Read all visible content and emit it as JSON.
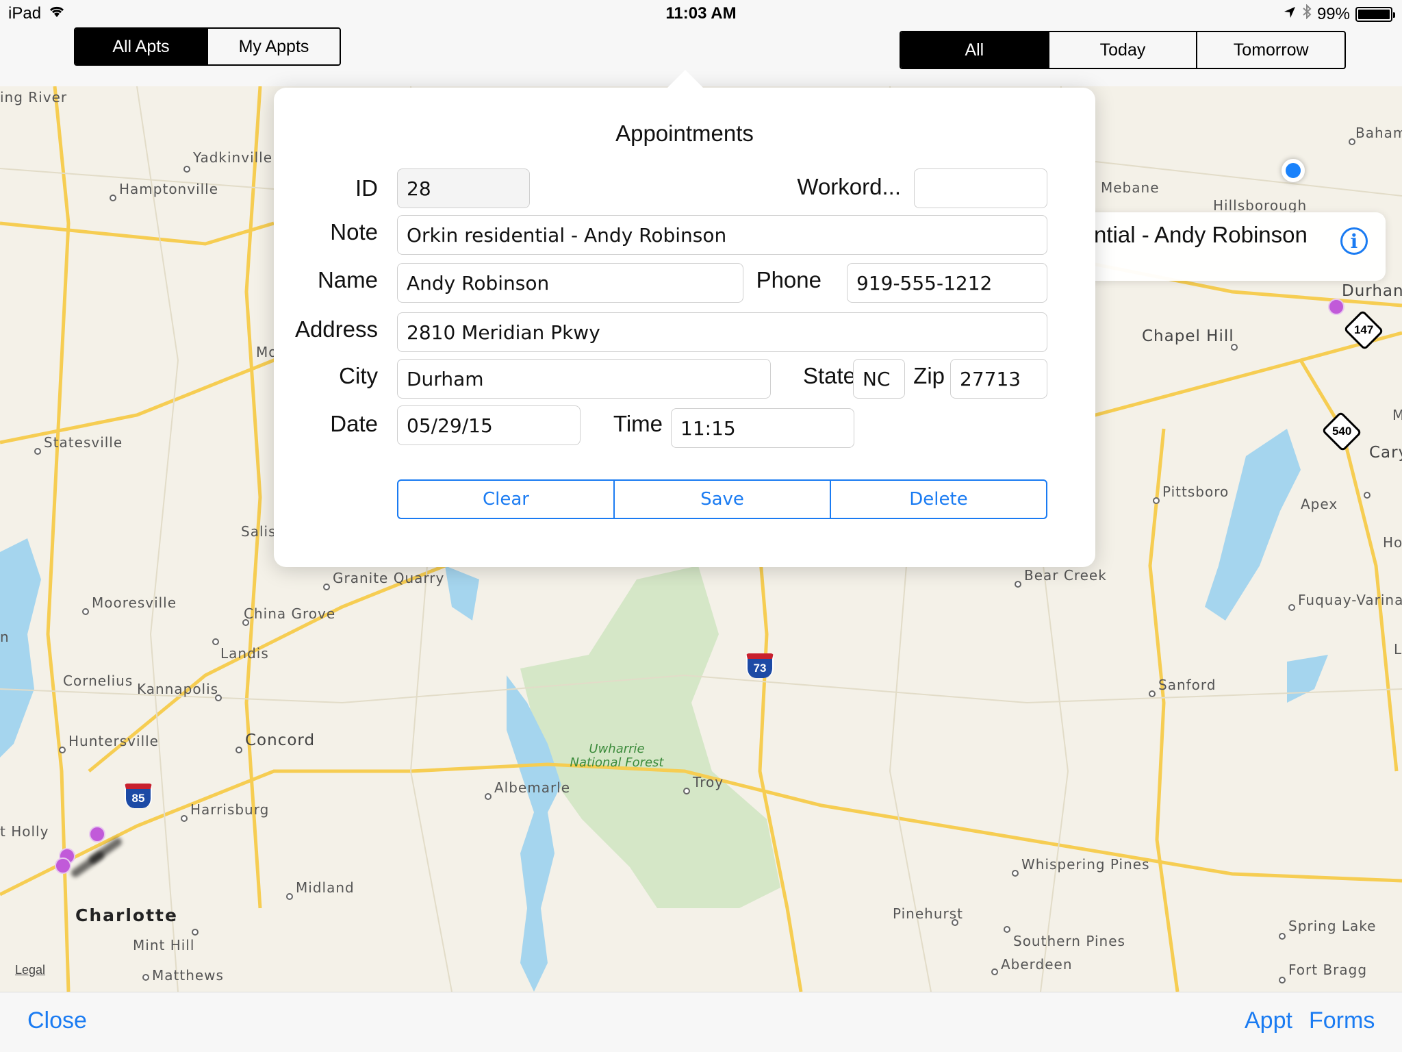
{
  "status_bar": {
    "device": "iPad",
    "time": "11:03 AM",
    "battery": "99%",
    "battery_level": 0.99
  },
  "toolbar": {
    "appt_scope": {
      "options": [
        "All Apts",
        "My Appts"
      ],
      "selected": "All Apts"
    },
    "date_filter": {
      "options": [
        "All",
        "Today",
        "Tomorrow"
      ],
      "selected": "All"
    }
  },
  "popover": {
    "title": "Appointments",
    "labels": {
      "id": "ID",
      "workorder": "Workord...",
      "note": "Note",
      "name": "Name",
      "phone": "Phone",
      "address": "Address",
      "city": "City",
      "state": "State",
      "zip": "Zip",
      "date": "Date",
      "time": "Time"
    },
    "values": {
      "id": "28",
      "workorder": "",
      "note": "Orkin residential - Andy Robinson",
      "name": "Andy Robinson",
      "phone": "919-555-1212",
      "address": "2810 Meridian Pkwy",
      "city": "Durham",
      "state": "NC",
      "zip": "27713",
      "date": "05/29/15",
      "time": "11:15"
    },
    "buttons": {
      "clear": "Clear",
      "save": "Save",
      "delete": "Delete"
    }
  },
  "map": {
    "callout_text": "ntial - Andy Robinson",
    "labels": {
      "ing_river": "ing River",
      "yadkinville": "Yadkinville",
      "hamptonville": "Hamptonville",
      "statesville": "Statesville",
      "mo": "Mo",
      "salis": "Salis",
      "mooresville": "Mooresville",
      "granite_quarry": "Granite Quarry",
      "china_grove": "China Grove",
      "landis": "Landis",
      "n": "n",
      "cornelius": "Cornelius",
      "kannapolis": "Kannapolis",
      "huntersville": "Huntersville",
      "concord": "Concord",
      "harrisburg": "Harrisburg",
      "holly": "t Holly",
      "charlotte": "Charlotte",
      "mint_hill": "Mint Hill",
      "matthews": "Matthews",
      "midland": "Midland",
      "albemarle": "Albemarle",
      "troy": "Troy",
      "uwharrie": "Uwharrie National Forest",
      "bear_creek": "Bear Creek",
      "whispering_pines": "Whispering Pines",
      "pinehurst": "Pinehurst",
      "southern_pines": "Southern Pines",
      "aberdeen": "Aberdeen",
      "sanford": "Sanford",
      "pittsboro": "Pittsboro",
      "apex": "Apex",
      "cary": "Cary",
      "ho": "Ho",
      "fuquay": "Fuquay-Varina",
      "chapel_hill": "Chapel Hill",
      "durham": "Durhan",
      "mebane": "Mebane",
      "hillsborough": "Hillsborough",
      "baham": "Baham",
      "spring_lake": "Spring Lake",
      "fort_bragg": "Fort Bragg",
      "m": "M",
      "l": "L",
      "legal": "Legal"
    },
    "shields": {
      "i73": "73",
      "i85": "85",
      "nc147": "147",
      "nc540": "540"
    },
    "colors": {
      "land": "#f4f1e8",
      "water": "#a5d5ee",
      "forest": "#d5e7c7",
      "road": "#f6cd52",
      "pin": "#c15ad9",
      "user_location": "#1a82fb",
      "accent": "#1a7bf2"
    }
  },
  "bottom_toolbar": {
    "close": "Close",
    "appt": "Appt",
    "forms": "Forms"
  }
}
